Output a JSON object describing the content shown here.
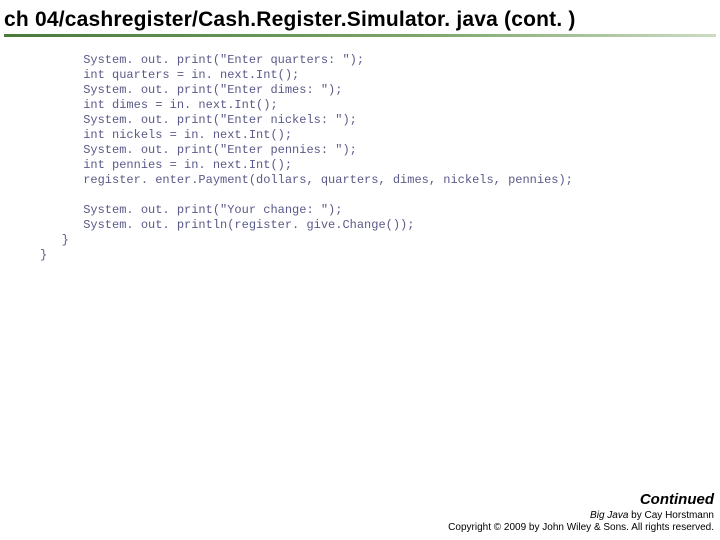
{
  "header": {
    "title": "ch 04/cashregister/Cash.Register.Simulator. java (cont. )"
  },
  "code": {
    "lines": [
      "      System. out. print(\"Enter quarters: \");",
      "      int quarters = in. next.Int();",
      "      System. out. print(\"Enter dimes: \");",
      "      int dimes = in. next.Int();",
      "      System. out. print(\"Enter nickels: \");",
      "      int nickels = in. next.Int();",
      "      System. out. print(\"Enter pennies: \");",
      "      int pennies = in. next.Int();",
      "      register. enter.Payment(dollars, quarters, dimes, nickels, pennies);",
      "",
      "      System. out. print(\"Your change: \");",
      "      System. out. println(register. give.Change());",
      "   }",
      "}"
    ]
  },
  "footer": {
    "continued": "Continued",
    "booktitle": "Big Java",
    "author": " by Cay Horstmann",
    "copyright": "Copyright © 2009 by John Wiley & Sons. All rights reserved."
  }
}
